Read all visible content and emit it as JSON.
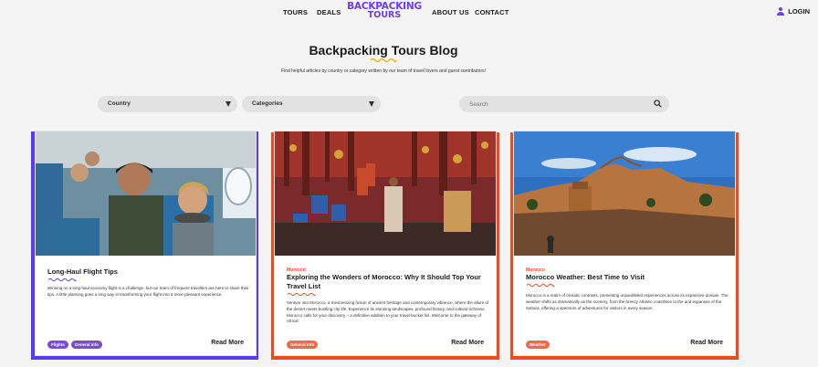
{
  "nav": {
    "tours": "TOURS",
    "deals": "DEALS",
    "logo_line1": "BACKPACKING",
    "logo_line2": "TOURS",
    "about": "ABOUT US",
    "contact": "CONTACT",
    "login": "LOGIN"
  },
  "page": {
    "title": "Backpacking Tours Blog",
    "subtitle": "Find helpful articles by country or category written by our team of travel lovers and guest contributors!"
  },
  "filters": {
    "country_label": "Country",
    "categories_label": "Categories",
    "search_placeholder": "Search"
  },
  "colors": {
    "purple": "#5b3bf0",
    "orange": "#f04a1e",
    "tag_purple": "#7a4bd8",
    "tag_orange": "#f06a4a"
  },
  "cards": [
    {
      "category": "",
      "title": "Long-Haul Flight Tips",
      "description": "Winning on a long-haul economy flight is a challenge, but our team of frequent travellers are here to share their tips. A little planning goes a long way in transforming your flight into a more pleasant experience.",
      "tags": [
        "Flights",
        "General Info"
      ],
      "read_more": "Read More"
    },
    {
      "category": "Morocco",
      "title": "Exploring the Wonders of Morocco: Why It Should Top Your Travel List",
      "description": "Venture into Morocco, a mesmerizing fusion of ancient heritage and contemporary vibrance, where the allure of the desert meets bustling city life. Experience its stunning landscapes, profound history, and cultural richness. Morocco calls for your discovery – a definitive addition to your travel bucket list. Welcome to the gateway of Africa!",
      "tags": [
        "General Info"
      ],
      "read_more": "Read More"
    },
    {
      "category": "Morocco",
      "title": "Morocco Weather: Best Time to Visit",
      "description": "Morocco is a realm of climatic contrasts, presenting unparalleled experiences across its expansive domain. The weather shifts as dramatically as the scenery, from the breezy Atlantic coastlines to the arid expanses of the Sahara, offering a spectrum of adventures for visitors in every season.",
      "tags": [
        "Weather"
      ],
      "read_more": "Read More"
    }
  ]
}
